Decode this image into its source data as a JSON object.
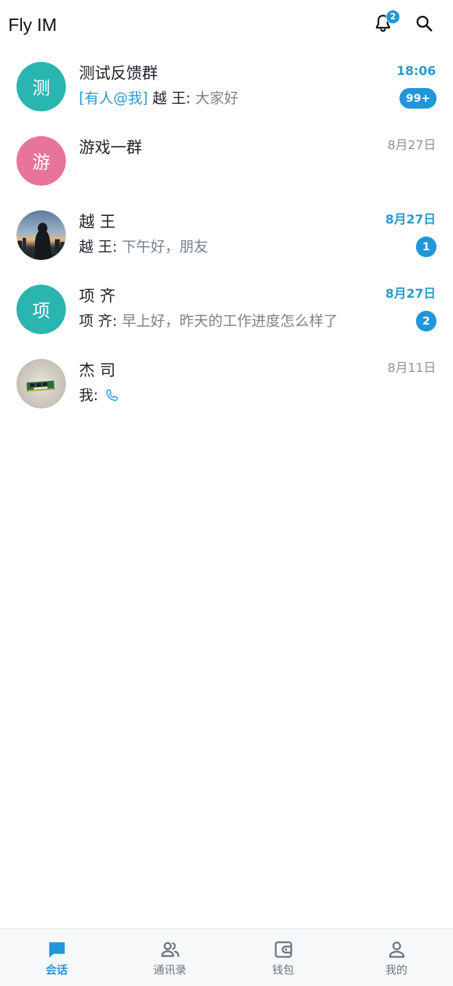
{
  "app": {
    "title": "Fly IM",
    "notification_count": "2",
    "accent_color": "#2196d8"
  },
  "conversations": [
    {
      "name": "测试反馈群",
      "avatar_text": "测",
      "avatar_color": "#2bb5b0",
      "time": "18:06",
      "mention": "[有人@我]",
      "sender": "越 王: ",
      "message": "大家好",
      "unread": "99+"
    },
    {
      "name": "游戏一群",
      "avatar_text": "游",
      "avatar_color": "#e8739b",
      "time": "8月27日"
    },
    {
      "name": "越 王",
      "avatar_icon": "photo-avatar-city-night",
      "time": "8月27日",
      "sender": "越 王: ",
      "message": "下午好，朋友",
      "unread": "1"
    },
    {
      "name": "项 齐",
      "avatar_text": "项",
      "avatar_color": "#2bb5b0",
      "time": "8月27日",
      "sender": "项 齐: ",
      "message": "早上好，昨天的工作进度怎么样了",
      "unread": "2"
    },
    {
      "name": "杰 司",
      "avatar_icon": "photo-avatar-memory-stick",
      "time": "8月11日",
      "sender": "我: ",
      "message_icon": "phone-icon"
    }
  ],
  "nav": [
    {
      "label": "会话",
      "icon": "chat-icon",
      "active": true
    },
    {
      "label": "通讯录",
      "icon": "contacts-icon",
      "active": false
    },
    {
      "label": "钱包",
      "icon": "wallet-icon",
      "active": false
    },
    {
      "label": "我的",
      "icon": "profile-icon",
      "active": false
    }
  ]
}
